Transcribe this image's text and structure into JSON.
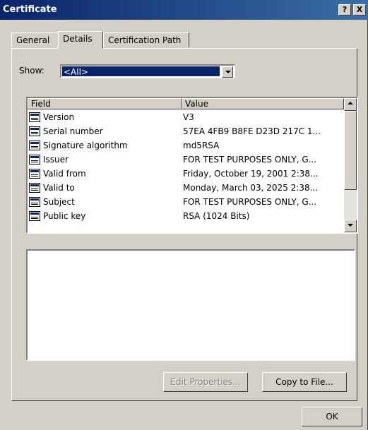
{
  "window": {
    "title": "Certificate",
    "help_label": "?",
    "close_label": "X"
  },
  "tabs": [
    {
      "label": "General"
    },
    {
      "label": "Details"
    },
    {
      "label": "Certification Path"
    }
  ],
  "show": {
    "label": "Show:",
    "selected": "<All>"
  },
  "list": {
    "columns": {
      "field": "Field",
      "value": "Value"
    },
    "rows": [
      {
        "field": "Version",
        "value": "V3"
      },
      {
        "field": "Serial number",
        "value": "57EA 4FB9 B8FE D23D 217C 1..."
      },
      {
        "field": "Signature algorithm",
        "value": "md5RSA"
      },
      {
        "field": "Issuer",
        "value": "FOR TEST PURPOSES ONLY, G..."
      },
      {
        "field": "Valid from",
        "value": "Friday, October 19, 2001 2:38..."
      },
      {
        "field": "Valid to",
        "value": "Monday, March 03, 2025 2:38..."
      },
      {
        "field": "Subject",
        "value": "FOR TEST PURPOSES ONLY, G..."
      },
      {
        "field": "Public key",
        "value": "RSA (1024 Bits)"
      }
    ]
  },
  "details_text": "",
  "buttons": {
    "edit_properties": "Edit Properties...",
    "copy_to_file": "Copy to File...",
    "ok": "OK"
  }
}
